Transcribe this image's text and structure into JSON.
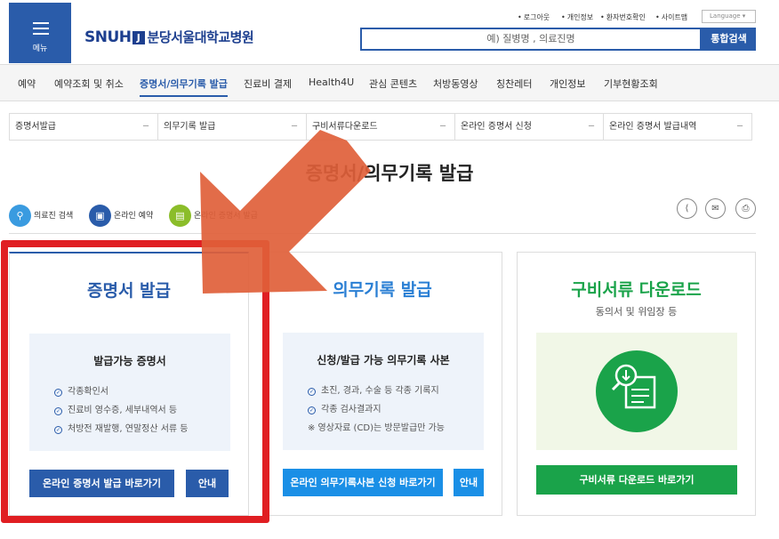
{
  "header": {
    "menu_label": "메뉴",
    "logo_en": "SNUH",
    "logo_mark": "J",
    "logo_ko": "분당서울대학교병원",
    "util_links": [
      "로그아웃",
      "개인정보",
      "환자번호확인",
      "사이트맵"
    ],
    "language": "Language",
    "search_placeholder": "예) 질병명 , 의료진명",
    "search_button": "통합검색"
  },
  "gnb": [
    "예약",
    "예약조회 및 취소",
    "증명서/의무기록 발급",
    "진료비 결제",
    "Health4U",
    "관심 콘텐츠",
    "처방동영상",
    "칭찬레터",
    "개인정보",
    "기부현황조회"
  ],
  "subnav": [
    "증명서발급",
    "의무기록 발급",
    "구비서류다운로드",
    "온라인 증명서 신청",
    "온라인 증명서 발급내역"
  ],
  "page_title": "증명서/의무기록 발급",
  "quick_links": [
    "의료진 검색",
    "온라인 예약",
    "온라인 증명서 발급"
  ],
  "cards": {
    "cert": {
      "title": "증명서 발급",
      "box_title": "발급가능 증명서",
      "items": [
        "각종확인서",
        "진료비 영수증, 세부내역서 등",
        "처방전 재발행, 연말정산 서류 등"
      ],
      "button": "온라인 증명서 발급 바로가기",
      "guide": "안내"
    },
    "record": {
      "title": "의무기록 발급",
      "box_title": "신청/발급 가능 의무기록 사본",
      "items": [
        "초진, 경과, 수술 등 각종 기록지",
        "각종 검사결과지"
      ],
      "note": "※ 영상자료 (CD)는 방문발급만 가능",
      "button": "온라인 의무기록사본 신청 바로가기",
      "guide": "안내"
    },
    "docs": {
      "title": "구비서류 다운로드",
      "subtitle": "동의서 및 위임장 등",
      "button": "구비서류 다운로드 바로가기"
    }
  },
  "colors": {
    "brand": "#2a5caa",
    "green": "#1aa34a",
    "highlight_red": "#e01e22",
    "arrow": "#e0603a"
  }
}
